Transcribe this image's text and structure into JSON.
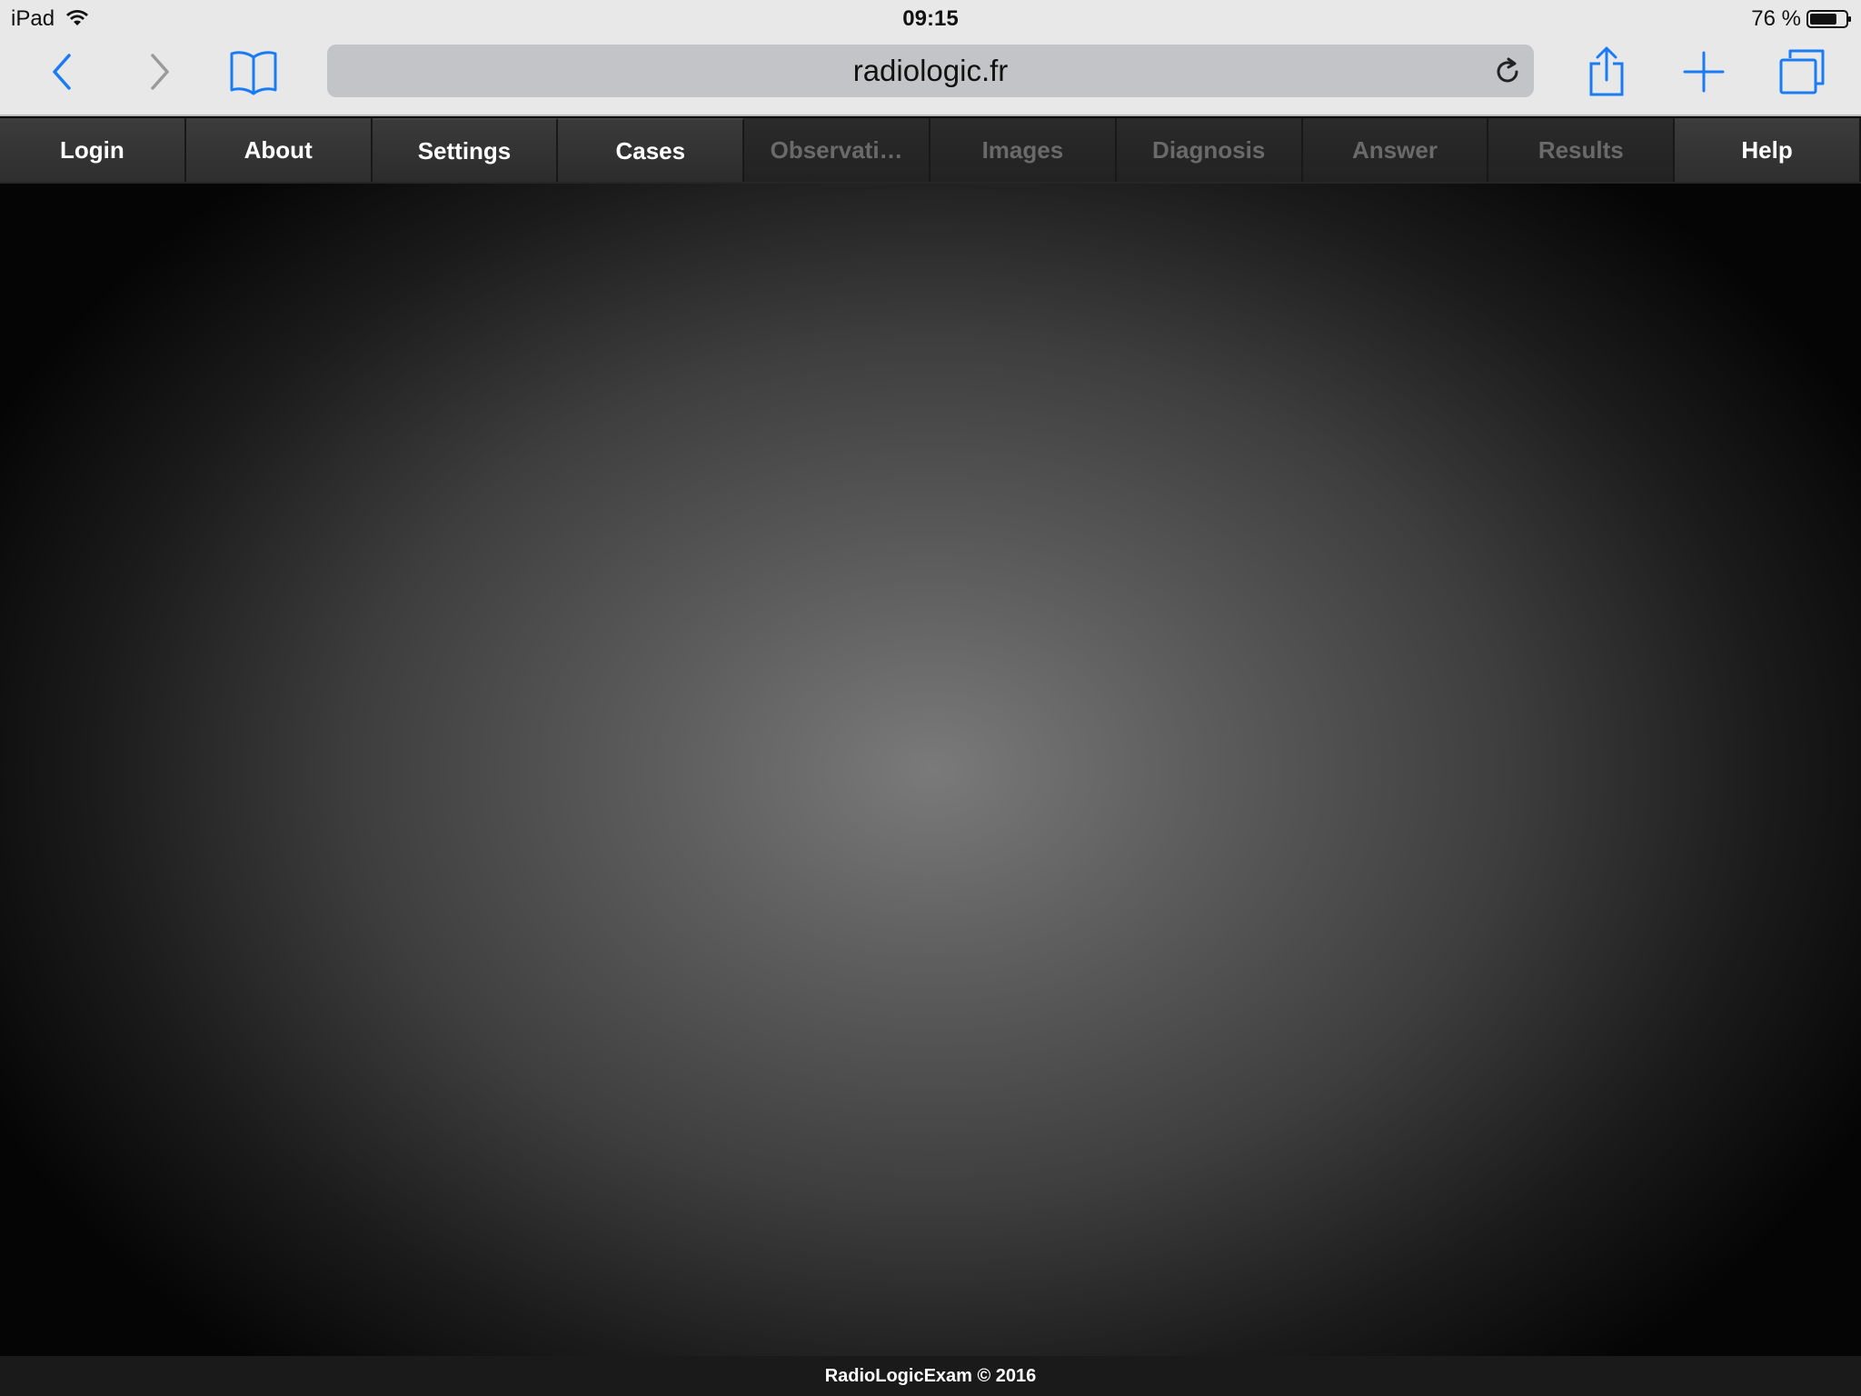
{
  "status_bar": {
    "device": "iPad",
    "time": "09:15",
    "battery": "76 %",
    "battery_level": 0.76
  },
  "browser": {
    "url": "radiologic.fr",
    "accent_color": "#1a7cf5",
    "icons": [
      "back-icon",
      "forward-icon",
      "bookmarks-icon",
      "reload-icon",
      "share-icon",
      "new-tab-icon",
      "tabs-icon"
    ]
  },
  "nav": {
    "tabs": [
      {
        "label": "Login",
        "enabled": true
      },
      {
        "label": "About",
        "enabled": true
      },
      {
        "label": "Settings",
        "enabled": true
      },
      {
        "label": "Cases",
        "enabled": true
      },
      {
        "label": "Observati…",
        "enabled": false
      },
      {
        "label": "Images",
        "enabled": false
      },
      {
        "label": "Diagnosis",
        "enabled": false
      },
      {
        "label": "Answer",
        "enabled": false
      },
      {
        "label": "Results",
        "enabled": false
      },
      {
        "label": "Help",
        "enabled": true
      }
    ]
  },
  "footer": {
    "text": "RadioLogicExam © 2016"
  }
}
